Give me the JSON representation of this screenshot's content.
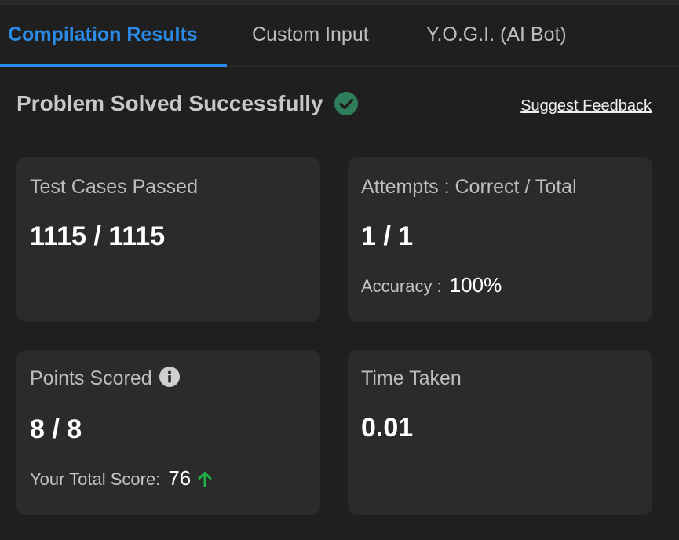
{
  "tabs": [
    {
      "label": "Compilation Results",
      "active": true
    },
    {
      "label": "Custom Input",
      "active": false
    },
    {
      "label": "Y.O.G.I. (AI Bot)",
      "active": false
    }
  ],
  "status": {
    "title": "Problem Solved Successfully",
    "icon": "check-circle-icon",
    "icon_color": "#2e7d5b"
  },
  "feedback_link": "Suggest Feedback",
  "cards": {
    "test_cases": {
      "label": "Test Cases Passed",
      "value": "1115 / 1115"
    },
    "attempts": {
      "label": "Attempts : Correct / Total",
      "value": "1 / 1",
      "accuracy_label": "Accuracy :",
      "accuracy_value": "100%"
    },
    "points": {
      "label": "Points Scored",
      "info_icon": "info-icon",
      "value": "8 / 8",
      "total_label": "Your Total Score:",
      "total_value": "76",
      "trend_icon": "arrow-up-icon",
      "trend_color": "#22b24c"
    },
    "time": {
      "label": "Time Taken",
      "value": "0.01"
    }
  },
  "colors": {
    "accent": "#2b8be8",
    "background": "#1f1f1f",
    "card": "#2b2b2b"
  }
}
